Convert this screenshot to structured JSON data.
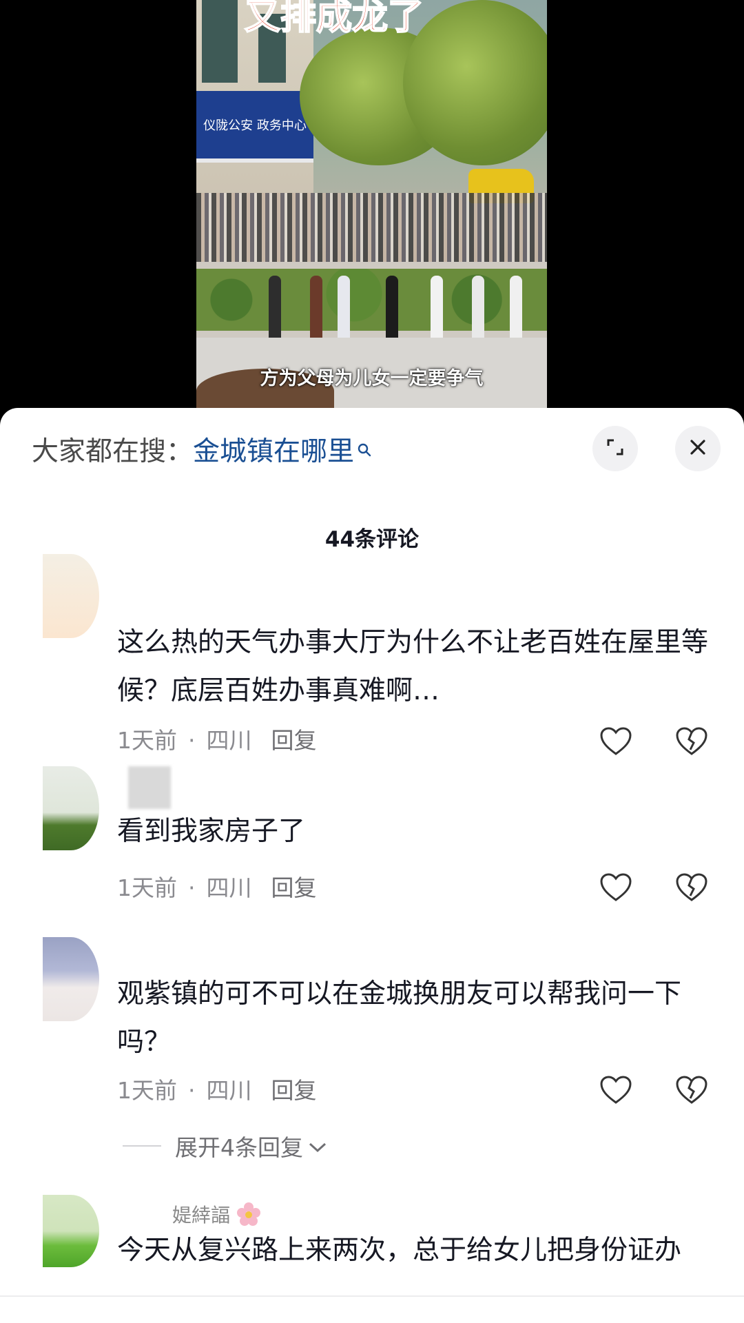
{
  "video": {
    "title_overlay": "又排成龙了",
    "sign_text": "仪陇公安 政务中心",
    "subtitle": "方为父母为儿女一定要争气"
  },
  "search": {
    "prefix": "大家都在搜：",
    "term": "金城镇在哪里"
  },
  "icons": {
    "search": "search-icon",
    "expand": "expand-icon",
    "close": "close-icon",
    "like": "heart-icon",
    "dislike": "broken-heart-icon",
    "chevron": "chevron-down-icon",
    "flower": "flower-emoji-icon"
  },
  "comments_header": {
    "count_label": "44条评论"
  },
  "comments": [
    {
      "text": "这么热的天气办事大厅为什么不让老百姓在屋里等候？底层百姓办事真难啊…",
      "time": "1天前",
      "location": "四川",
      "reply_label": "回复"
    },
    {
      "text": "看到我家房子了",
      "time": "1天前",
      "location": "四川",
      "reply_label": "回复"
    },
    {
      "text": "观紫镇的可不可以在金城换朋友可以帮我问一下吗？",
      "time": "1天前",
      "location": "四川",
      "reply_label": "回复",
      "expand_replies": "展开4条回复"
    },
    {
      "username": "媞緈諨",
      "text": "今天从复兴路上来两次，总于给女儿把身份证办"
    }
  ],
  "colors": {
    "link_blue": "#1a4f93",
    "text_primary": "#161823",
    "text_secondary": "#8a8a8f",
    "sheet_bg": "#ffffff"
  }
}
